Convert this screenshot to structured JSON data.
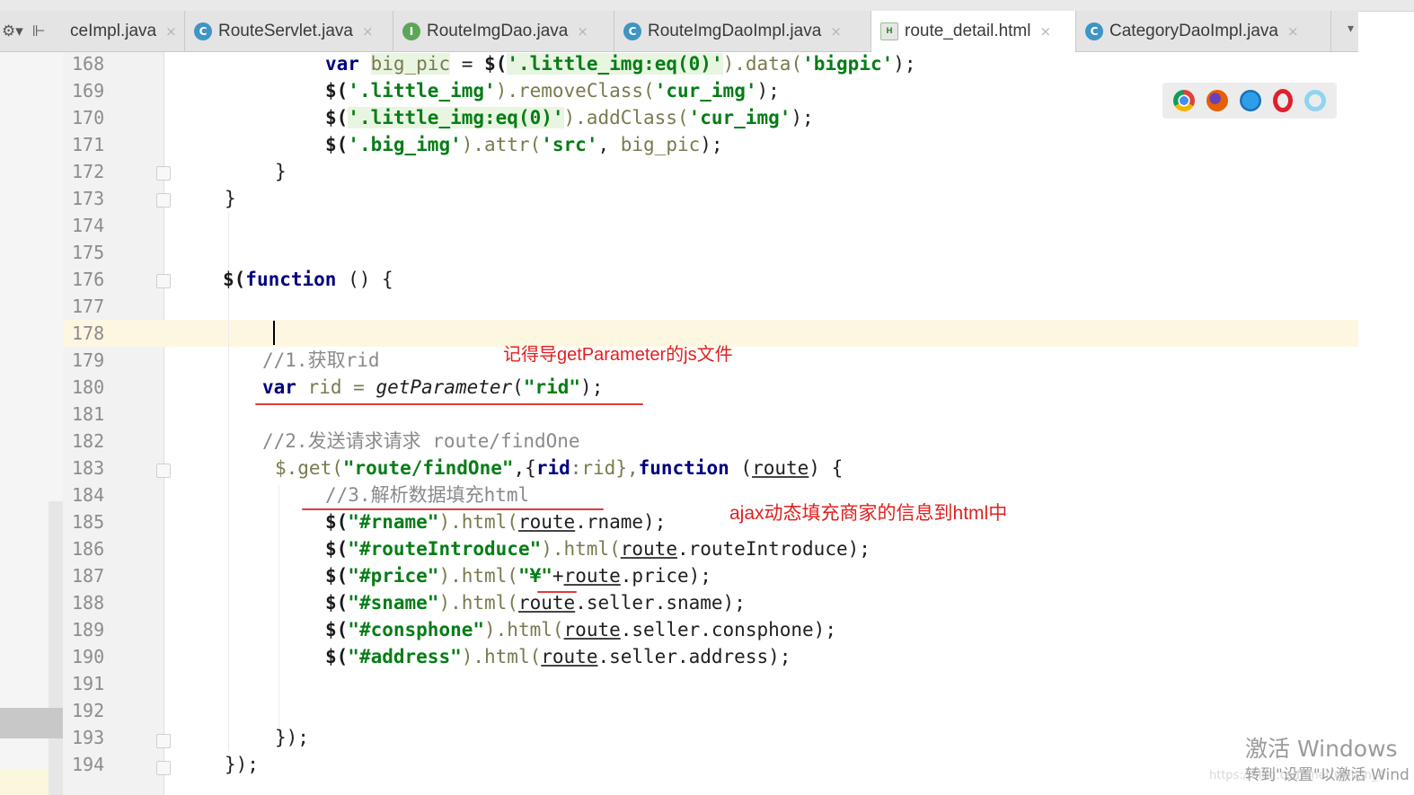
{
  "tabs": [
    {
      "label": "ceImpl.java",
      "icon": "none",
      "active": false
    },
    {
      "label": "RouteServlet.java",
      "icon": "C",
      "active": false
    },
    {
      "label": "RouteImgDao.java",
      "icon": "I",
      "active": false
    },
    {
      "label": "RouteImgDaoImpl.java",
      "icon": "C",
      "active": false
    },
    {
      "label": "route_detail.html",
      "icon": "html",
      "active": true
    },
    {
      "label": "CategoryDaoImpl.java",
      "icon": "C",
      "active": false
    }
  ],
  "tab_close_glyph": "×",
  "line_numbers": [
    "168",
    "169",
    "170",
    "171",
    "172",
    "173",
    "174",
    "175",
    "176",
    "177",
    "178",
    "179",
    "180",
    "181",
    "182",
    "183",
    "184",
    "185",
    "186",
    "187",
    "188",
    "189",
    "190",
    "191",
    "192",
    "193",
    "194"
  ],
  "code": {
    "l168": [
      "var",
      "big_pic",
      "=",
      "$(",
      "'.little_img:eq(0)'",
      ").data(",
      "'bigpic'",
      ");"
    ],
    "l169": [
      "$(",
      "'.little_img'",
      ").removeClass(",
      "'cur_img'",
      ");"
    ],
    "l170": [
      "$(",
      "'.little_img:eq(0)'",
      ").addClass(",
      "'cur_img'",
      ");"
    ],
    "l171": [
      "$(",
      "'.big_img'",
      ").attr(",
      "'src'",
      ", ",
      "big_pic",
      ");"
    ],
    "l172": "}",
    "l173": "}",
    "l176": [
      "$(",
      "function",
      " () {"
    ],
    "l179": "//1.获取rid",
    "l180": [
      "var",
      " rid = ",
      "getParameter",
      "(",
      "\"rid\"",
      ");"
    ],
    "l182": "//2.发送请求请求 route/findOne",
    "l183": [
      "$.get(",
      "\"route/findOne\"",
      ",{",
      "rid",
      ":rid},",
      "function",
      " (",
      "route",
      ") {"
    ],
    "l184": "//3.解析数据填充html",
    "l185": [
      "$(",
      "\"#rname\"",
      ").html(",
      "route",
      ".rname);"
    ],
    "l186": [
      "$(",
      "\"#routeIntroduce\"",
      ").html(",
      "route",
      ".routeIntroduce);"
    ],
    "l187": [
      "$(",
      "\"#price\"",
      ").html(",
      "\"¥\"",
      "+",
      "route",
      ".price);"
    ],
    "l188": [
      "$(",
      "\"#sname\"",
      ").html(",
      "route",
      ".seller.sname);"
    ],
    "l189": [
      "$(",
      "\"#consphone\"",
      ").html(",
      "route",
      ".seller.consphone);"
    ],
    "l190": [
      "$(",
      "\"#address\"",
      ").html(",
      "route",
      ".seller.address);"
    ],
    "l193": "});",
    "l194": "});"
  },
  "annotations": {
    "note1": "记得导getParameter的js文件",
    "note2": "ajax动态填充商家的信息到html中"
  },
  "browser_icons": [
    "chrome-icon",
    "firefox-icon",
    "safari-icon",
    "opera-icon",
    "ie-icon"
  ],
  "watermark": {
    "line1": "激活 Windows",
    "line2": "转到\"设置\"以激活 Wind",
    "url": "https://blog.csdn.net/weixin_4"
  },
  "colors": {
    "keyword": "#000080",
    "string": "#067d17",
    "annotation": "#e02020",
    "current_line": "#fdf7e2"
  }
}
